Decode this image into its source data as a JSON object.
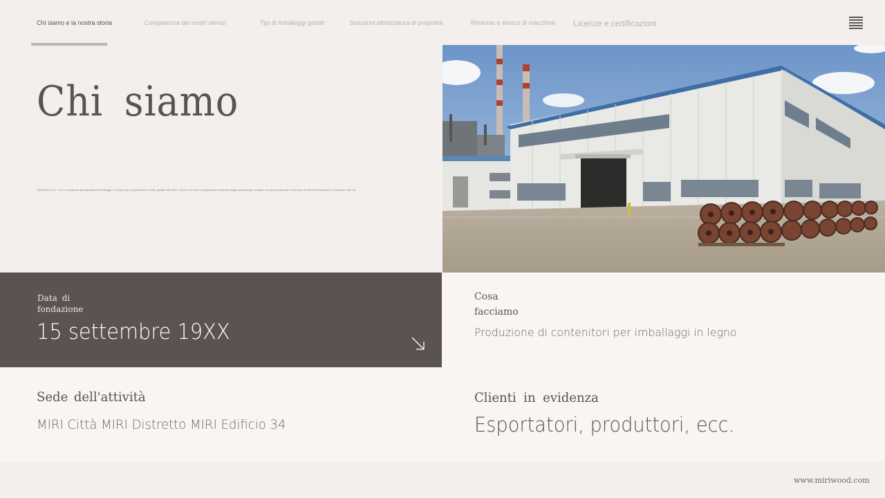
{
  "nav": {
    "items": [
      "Chi siamo e la nostra storia",
      "Competenza dei nostri servizi",
      "Tipi di imballaggi gestiti",
      "Soluzioni attrezzatura di proprietà",
      "Rimesse e elenco di macchine",
      "Licenze e certificazioni"
    ],
    "active_index": 0
  },
  "hero": {
    "title": "Chi siamo",
    "description": "MIRI Wood Co., Ltd. è un'azienda specializzata in imballaggi e in legno per la spedizione a livello globale dal 19XX. Grazie a 20 anni di esperienza e alla tecnologia accumulata, forniamo un servizio generico di servizio ai clienti di esportatori e industria e alle altre."
  },
  "founded": {
    "label": "Data di fondazione",
    "value": "15 settembre 19XX"
  },
  "what_we_do": {
    "label": "Cosa facciamo",
    "value": "Produzione di contenitori per imballaggi in legno"
  },
  "headquarters": {
    "label": "Sede dell'attività",
    "value": "MIRI Città MIRI Distretto MIRI Edificio 34"
  },
  "clients": {
    "label": "Clienti in evidenza",
    "value": "Esportatori, produttori, ecc."
  },
  "footer": {
    "url": "www.miriwood.com"
  },
  "colors": {
    "background": "#f2efed",
    "dark_panel": "#5b5351",
    "light_panel": "#f8f5f3",
    "text": "#5b5351",
    "nav_muted": "#b9b1ae"
  },
  "icons": {
    "menu": "hamburger-menu-icon",
    "arrow": "arrow-down-right-icon"
  }
}
